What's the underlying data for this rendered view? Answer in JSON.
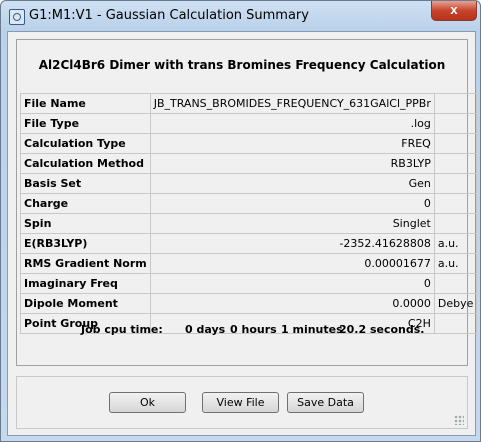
{
  "window": {
    "title": "G1:M1:V1 - Gaussian Calculation Summary",
    "close_label": "x"
  },
  "summary": {
    "heading": "Al2Cl4Br6 Dimer with trans Bromines Frequency Calculation",
    "rows": [
      {
        "label": "File Name",
        "value": "JB_TRANS_BROMIDES_FREQUENCY_631GAlCl_PPBr",
        "unit": ""
      },
      {
        "label": "File Type",
        "value": ".log",
        "unit": ""
      },
      {
        "label": "Calculation Type",
        "value": "FREQ",
        "unit": ""
      },
      {
        "label": "Calculation Method",
        "value": "RB3LYP",
        "unit": ""
      },
      {
        "label": "Basis Set",
        "value": "Gen",
        "unit": ""
      },
      {
        "label": "Charge",
        "value": "0",
        "unit": ""
      },
      {
        "label": "Spin",
        "value": "Singlet",
        "unit": ""
      },
      {
        "label": "E(RB3LYP)",
        "value": "-2352.41628808",
        "unit": "a.u."
      },
      {
        "label": "RMS Gradient Norm",
        "value": "0.00001677",
        "unit": "a.u."
      },
      {
        "label": "Imaginary Freq",
        "value": "0",
        "unit": ""
      },
      {
        "label": "Dipole Moment",
        "value": "0.0000",
        "unit": "Debye"
      },
      {
        "label": "Point Group",
        "value": "C2H",
        "unit": ""
      }
    ],
    "cpu": {
      "label": "Job cpu time:",
      "days": "0 days",
      "hours": "0 hours",
      "minutes": "1 minutes",
      "seconds": "20.2 seconds."
    }
  },
  "buttons": {
    "ok": "Ok",
    "view_file": "View File",
    "save_data": "Save Data"
  },
  "icons": {
    "app": "gaussview-app-icon",
    "close": "close-icon",
    "grip": "resize-grip-icon"
  }
}
